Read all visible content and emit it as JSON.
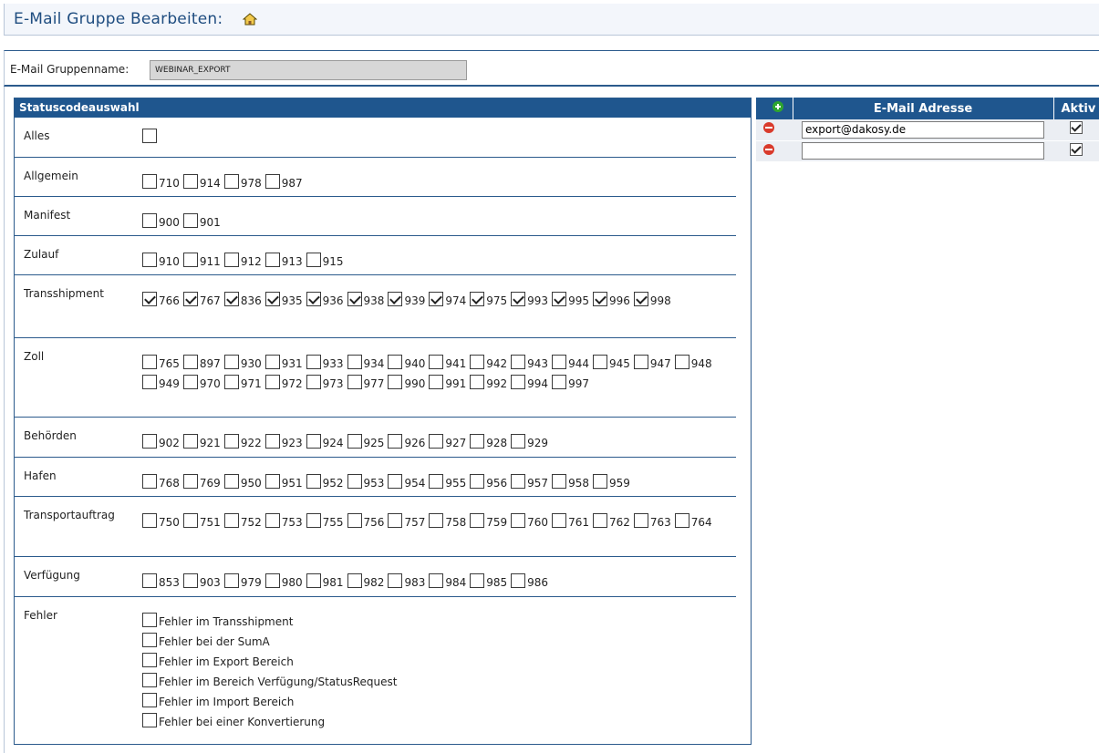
{
  "header": {
    "title": "E-Mail Gruppe Bearbeiten:",
    "home_icon": "home-icon"
  },
  "group": {
    "label": "E-Mail Gruppenname:",
    "value": "WEBINAR_EXPORT"
  },
  "status": {
    "title": "Statuscodeauswahl",
    "rows": [
      {
        "label": "Alles",
        "items": [
          {
            "code": "",
            "checked": false
          }
        ]
      },
      {
        "label": "Allgemein",
        "items": [
          {
            "code": "710",
            "checked": false
          },
          {
            "code": "914",
            "checked": false
          },
          {
            "code": "978",
            "checked": false
          },
          {
            "code": "987",
            "checked": false
          }
        ]
      },
      {
        "label": "Manifest",
        "items": [
          {
            "code": "900",
            "checked": false
          },
          {
            "code": "901",
            "checked": false
          }
        ]
      },
      {
        "label": "Zulauf",
        "items": [
          {
            "code": "910",
            "checked": false
          },
          {
            "code": "911",
            "checked": false
          },
          {
            "code": "912",
            "checked": false
          },
          {
            "code": "913",
            "checked": false
          },
          {
            "code": "915",
            "checked": false
          }
        ]
      },
      {
        "label": "Transshipment",
        "items": [
          {
            "code": "766",
            "checked": true
          },
          {
            "code": "767",
            "checked": true
          },
          {
            "code": "836",
            "checked": true
          },
          {
            "code": "935",
            "checked": true
          },
          {
            "code": "936",
            "checked": true
          },
          {
            "code": "938",
            "checked": true
          },
          {
            "code": "939",
            "checked": true
          },
          {
            "code": "974",
            "checked": true
          },
          {
            "code": "975",
            "checked": true
          },
          {
            "code": "993",
            "checked": true
          },
          {
            "code": "995",
            "checked": true
          },
          {
            "code": "996",
            "checked": true
          },
          {
            "code": "998",
            "checked": true
          }
        ]
      },
      {
        "label": "Zoll",
        "items": [
          {
            "code": "765",
            "checked": false
          },
          {
            "code": "897",
            "checked": false
          },
          {
            "code": "930",
            "checked": false
          },
          {
            "code": "931",
            "checked": false
          },
          {
            "code": "933",
            "checked": false
          },
          {
            "code": "934",
            "checked": false
          },
          {
            "code": "940",
            "checked": false
          },
          {
            "code": "941",
            "checked": false
          },
          {
            "code": "942",
            "checked": false
          },
          {
            "code": "943",
            "checked": false
          },
          {
            "code": "944",
            "checked": false
          },
          {
            "code": "945",
            "checked": false
          },
          {
            "code": "947",
            "checked": false
          },
          {
            "code": "948",
            "checked": false
          },
          {
            "code": "949",
            "checked": false
          },
          {
            "code": "970",
            "checked": false
          },
          {
            "code": "971",
            "checked": false
          },
          {
            "code": "972",
            "checked": false
          },
          {
            "code": "973",
            "checked": false
          },
          {
            "code": "977",
            "checked": false
          },
          {
            "code": "990",
            "checked": false
          },
          {
            "code": "991",
            "checked": false
          },
          {
            "code": "992",
            "checked": false
          },
          {
            "code": "994",
            "checked": false
          },
          {
            "code": "997",
            "checked": false
          }
        ]
      },
      {
        "label": "Behörden",
        "items": [
          {
            "code": "902",
            "checked": false
          },
          {
            "code": "921",
            "checked": false
          },
          {
            "code": "922",
            "checked": false
          },
          {
            "code": "923",
            "checked": false
          },
          {
            "code": "924",
            "checked": false
          },
          {
            "code": "925",
            "checked": false
          },
          {
            "code": "926",
            "checked": false
          },
          {
            "code": "927",
            "checked": false
          },
          {
            "code": "928",
            "checked": false
          },
          {
            "code": "929",
            "checked": false
          }
        ]
      },
      {
        "label": "Hafen",
        "items": [
          {
            "code": "768",
            "checked": false
          },
          {
            "code": "769",
            "checked": false
          },
          {
            "code": "950",
            "checked": false
          },
          {
            "code": "951",
            "checked": false
          },
          {
            "code": "952",
            "checked": false
          },
          {
            "code": "953",
            "checked": false
          },
          {
            "code": "954",
            "checked": false
          },
          {
            "code": "955",
            "checked": false
          },
          {
            "code": "956",
            "checked": false
          },
          {
            "code": "957",
            "checked": false
          },
          {
            "code": "958",
            "checked": false
          },
          {
            "code": "959",
            "checked": false
          }
        ]
      },
      {
        "label": "Transportauftrag",
        "items": [
          {
            "code": "750",
            "checked": false
          },
          {
            "code": "751",
            "checked": false
          },
          {
            "code": "752",
            "checked": false
          },
          {
            "code": "753",
            "checked": false
          },
          {
            "code": "755",
            "checked": false
          },
          {
            "code": "756",
            "checked": false
          },
          {
            "code": "757",
            "checked": false
          },
          {
            "code": "758",
            "checked": false
          },
          {
            "code": "759",
            "checked": false
          },
          {
            "code": "760",
            "checked": false
          },
          {
            "code": "761",
            "checked": false
          },
          {
            "code": "762",
            "checked": false
          },
          {
            "code": "763",
            "checked": false
          },
          {
            "code": "764",
            "checked": false
          }
        ]
      },
      {
        "label": "Verfügung",
        "items": [
          {
            "code": "853",
            "checked": false
          },
          {
            "code": "903",
            "checked": false
          },
          {
            "code": "979",
            "checked": false
          },
          {
            "code": "980",
            "checked": false
          },
          {
            "code": "981",
            "checked": false
          },
          {
            "code": "982",
            "checked": false
          },
          {
            "code": "983",
            "checked": false
          },
          {
            "code": "984",
            "checked": false
          },
          {
            "code": "985",
            "checked": false
          },
          {
            "code": "986",
            "checked": false
          }
        ]
      },
      {
        "label": "Fehler",
        "list": true,
        "items": [
          {
            "code": "Fehler im Transshipment",
            "checked": false
          },
          {
            "code": "Fehler bei der SumA",
            "checked": false
          },
          {
            "code": "Fehler im Export Bereich",
            "checked": false
          },
          {
            "code": "Fehler im Bereich Verfügung/StatusRequest",
            "checked": false
          },
          {
            "code": "Fehler im Import Bereich",
            "checked": false
          },
          {
            "code": "Fehler bei einer Konvertierung",
            "checked": false
          }
        ]
      }
    ]
  },
  "emails": {
    "header_email": "E-Mail Adresse",
    "header_active": "Aktiv",
    "rows": [
      {
        "address": "export@dakosy.de",
        "active": true
      },
      {
        "address": "",
        "active": true
      }
    ]
  },
  "colors": {
    "header_blue": "#1f568e",
    "border_blue": "#2b5a8c",
    "title_blue": "#1f4d80"
  }
}
